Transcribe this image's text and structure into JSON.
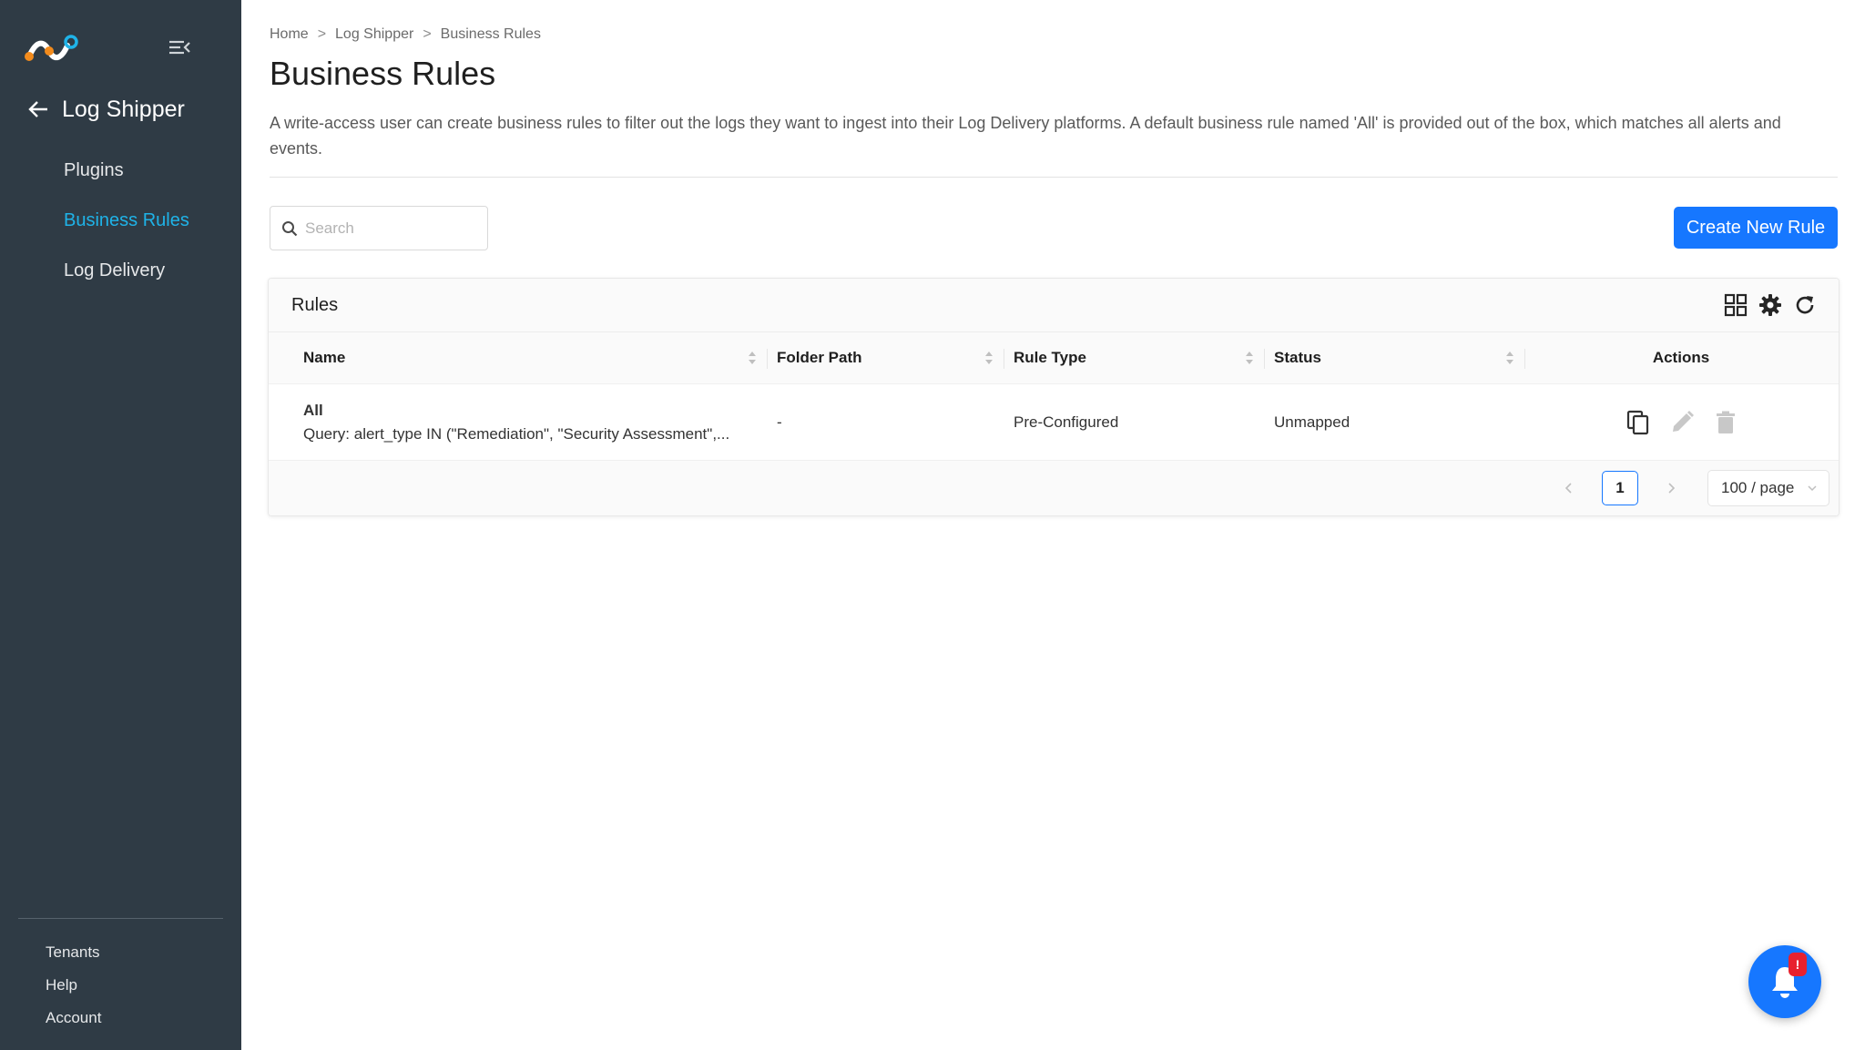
{
  "sidebar": {
    "section_title": "Log Shipper",
    "items": [
      {
        "label": "Plugins",
        "active": false
      },
      {
        "label": "Business Rules",
        "active": true
      },
      {
        "label": "Log Delivery",
        "active": false
      }
    ],
    "bottom_items": [
      {
        "label": "Tenants"
      },
      {
        "label": "Help"
      },
      {
        "label": "Account"
      }
    ]
  },
  "breadcrumb": [
    "Home",
    "Log Shipper",
    "Business Rules"
  ],
  "breadcrumb_separator": ">",
  "page": {
    "title": "Business Rules",
    "description": "A write-access user can create business rules to filter out the logs they want to ingest into their Log Delivery platforms. A default business rule named 'All' is provided out of the box, which matches all alerts and events."
  },
  "search": {
    "placeholder": "Search",
    "value": ""
  },
  "create_button": {
    "label": "Create New Rule"
  },
  "table": {
    "title": "Rules",
    "columns": [
      "Name",
      "Folder Path",
      "Rule Type",
      "Status",
      "Actions"
    ],
    "rows": [
      {
        "name": "All",
        "query": "Query: alert_type IN (\"Remediation\", \"Security Assessment\",...",
        "folder_path": "-",
        "rule_type": "Pre-Configured",
        "status": "Unmapped"
      }
    ]
  },
  "pagination": {
    "current_page": "1",
    "page_size": "100 / page"
  },
  "notification": {
    "badge": "!"
  },
  "colors": {
    "sidebar_bg": "#2f3b45",
    "active_nav": "#1fb3e8",
    "primary": "#1677ff",
    "badge": "#e8212e"
  },
  "icons": {
    "logo": "brand-logo-icon",
    "collapse": "menu-collapse-icon",
    "back": "arrow-left-icon",
    "search": "search-icon",
    "grid": "grid-view-icon",
    "settings": "gear-icon",
    "refresh": "refresh-icon",
    "copy": "copy-icon",
    "edit": "pencil-icon",
    "delete": "trash-icon",
    "bell": "bell-icon"
  }
}
